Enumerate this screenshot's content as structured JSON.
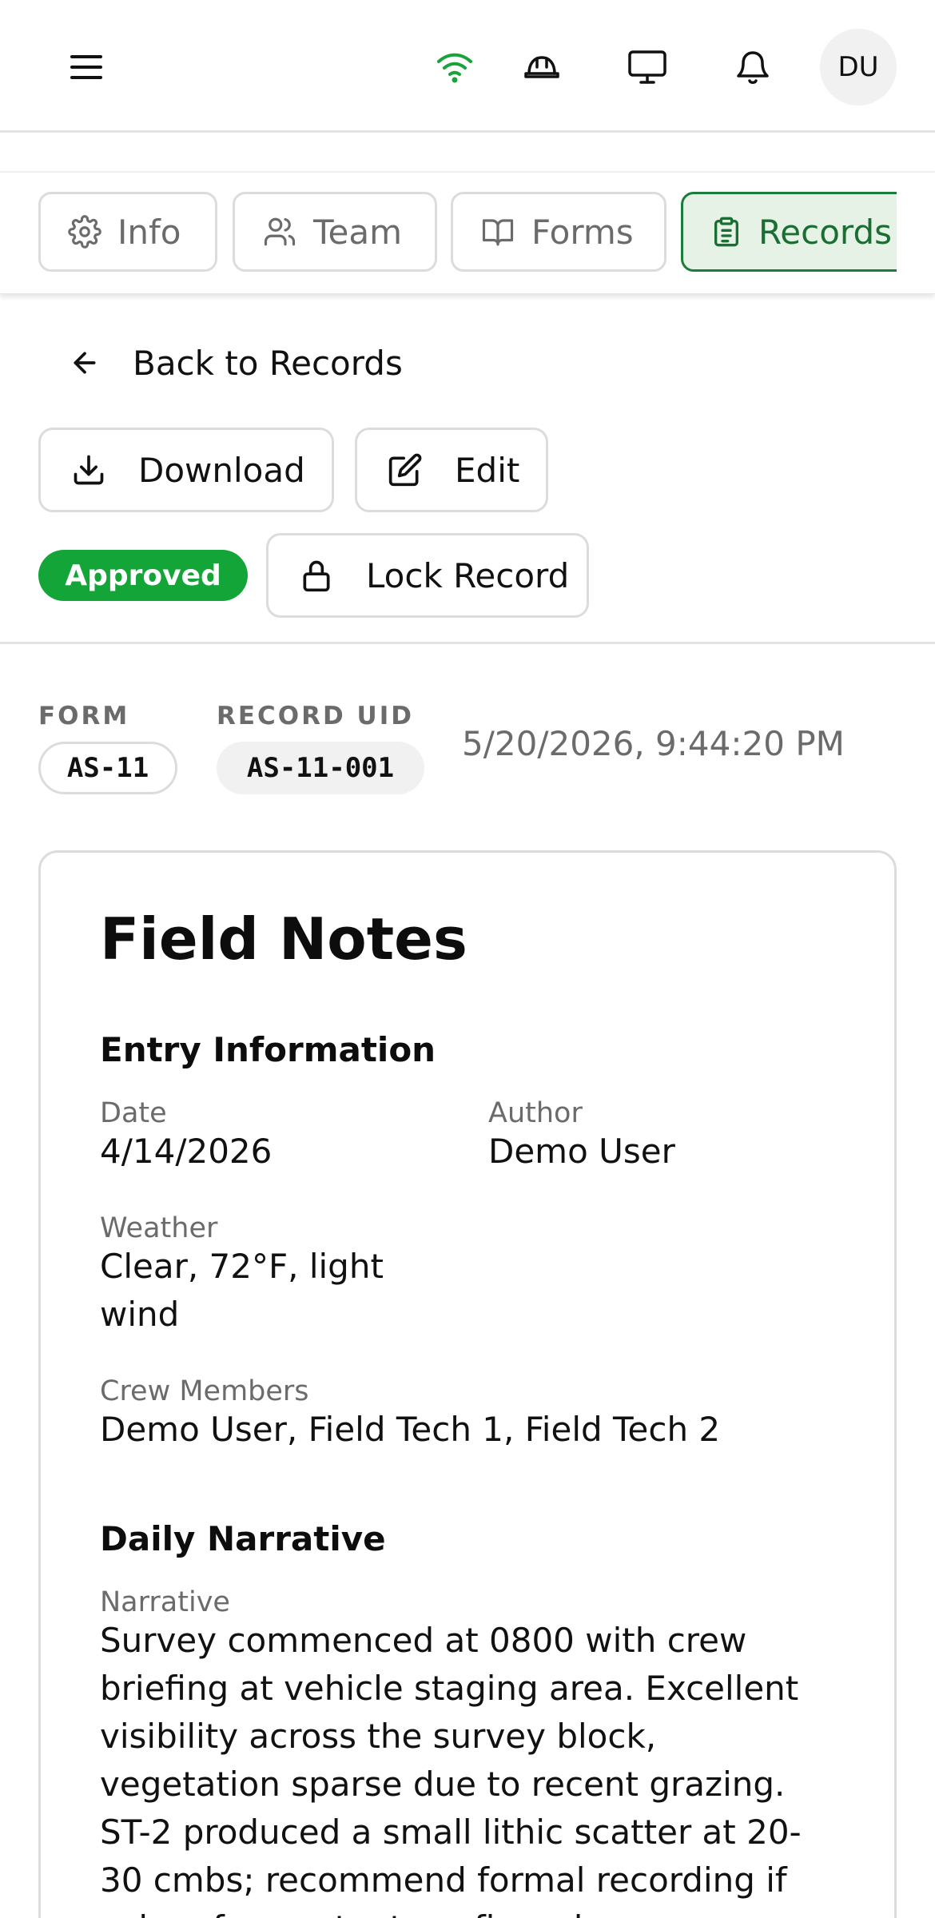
{
  "header": {
    "avatar_initials": "DU",
    "wifi_color": "#1aa33a"
  },
  "tabs": [
    {
      "label": "Info",
      "icon": "gear-icon"
    },
    {
      "label": "Team",
      "icon": "users-icon"
    },
    {
      "label": "Forms",
      "icon": "book-icon"
    },
    {
      "label": "Records",
      "icon": "clipboard-icon",
      "active": true
    }
  ],
  "nav": {
    "back_label": "Back to Records"
  },
  "actions": {
    "download_label": "Download",
    "edit_label": "Edit",
    "status_badge": "Approved",
    "lock_label": "Lock Record"
  },
  "meta": {
    "form_label": "FORM",
    "form_value": "AS-11",
    "record_uid_label": "RECORD UID",
    "record_uid_value": "AS-11-001",
    "timestamp": "5/20/2026, 9:44:20 PM"
  },
  "record": {
    "title": "Field Notes",
    "entry_section": "Entry Information",
    "date_label": "Date",
    "date_value": "4/14/2026",
    "author_label": "Author",
    "author_value": "Demo User",
    "weather_label": "Weather",
    "weather_value": "Clear, 72°F, light wind",
    "crew_label": "Crew Members",
    "crew_value": "Demo User, Field Tech 1, Field Tech 2",
    "narrative_section": "Daily Narrative",
    "narrative_label": "Narrative",
    "narrative_value": "Survey commenced at 0800 with crew briefing at vehicle staging area. Excellent visibility across the survey block, vegetation sparse due to recent grazing. ST-2 produced a small lithic scatter at 20-30 cmbs; recommend formal recording if subsurface extent confirmed."
  },
  "colors": {
    "accent": "#1b7d3a",
    "badge": "#13a538",
    "muted_text": "#6b6b6b"
  }
}
